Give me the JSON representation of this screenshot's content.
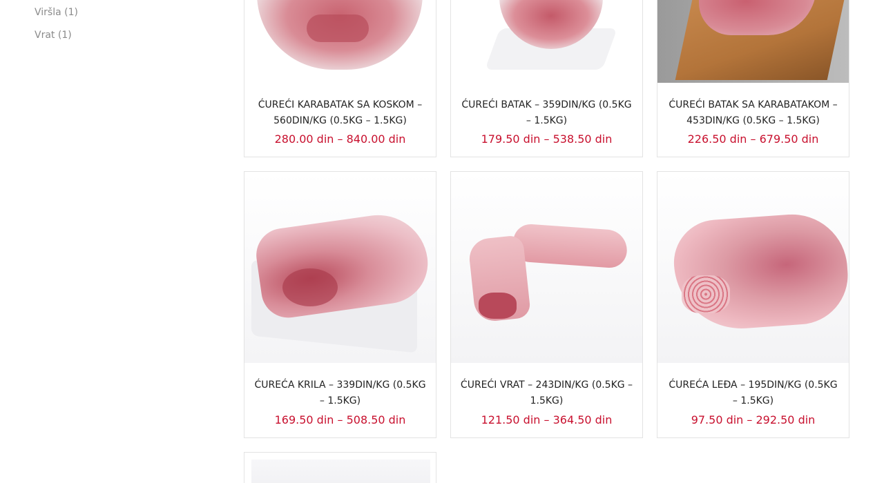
{
  "sidebar": {
    "categories": [
      {
        "label": "Viršla (1)"
      },
      {
        "label": "Vrat (1)"
      }
    ]
  },
  "products": [
    {
      "title": "ĆUREĆI KARABATAK SA KOSKOM – 560DIN/KG (0.5KG – 1.5KG)",
      "price": "280.00 din – 840.00 din"
    },
    {
      "title": "ĆUREĆI BATAK – 359DIN/KG (0.5KG – 1.5KG)",
      "price": "179.50 din – 538.50 din"
    },
    {
      "title": "ĆUREĆI BATAK SA KARABATAKOM – 453DIN/KG (0.5KG – 1.5KG)",
      "price": "226.50 din – 679.50 din"
    },
    {
      "title": "ĆUREĆA KRILA – 339DIN/KG (0.5KG – 1.5KG)",
      "price": "169.50 din – 508.50 din"
    },
    {
      "title": "ĆUREĆI VRAT – 243DIN/KG (0.5KG – 1.5KG)",
      "price": "121.50 din – 364.50 din"
    },
    {
      "title": "ĆUREĆA LEĐA – 195DIN/KG (0.5KG – 1.5KG)",
      "price": "97.50 din – 292.50 din"
    }
  ],
  "colors": {
    "price": "#c8102e",
    "border": "#e3e3e3",
    "meat": "#e8a3ab",
    "meat_dark": "#b94858"
  }
}
